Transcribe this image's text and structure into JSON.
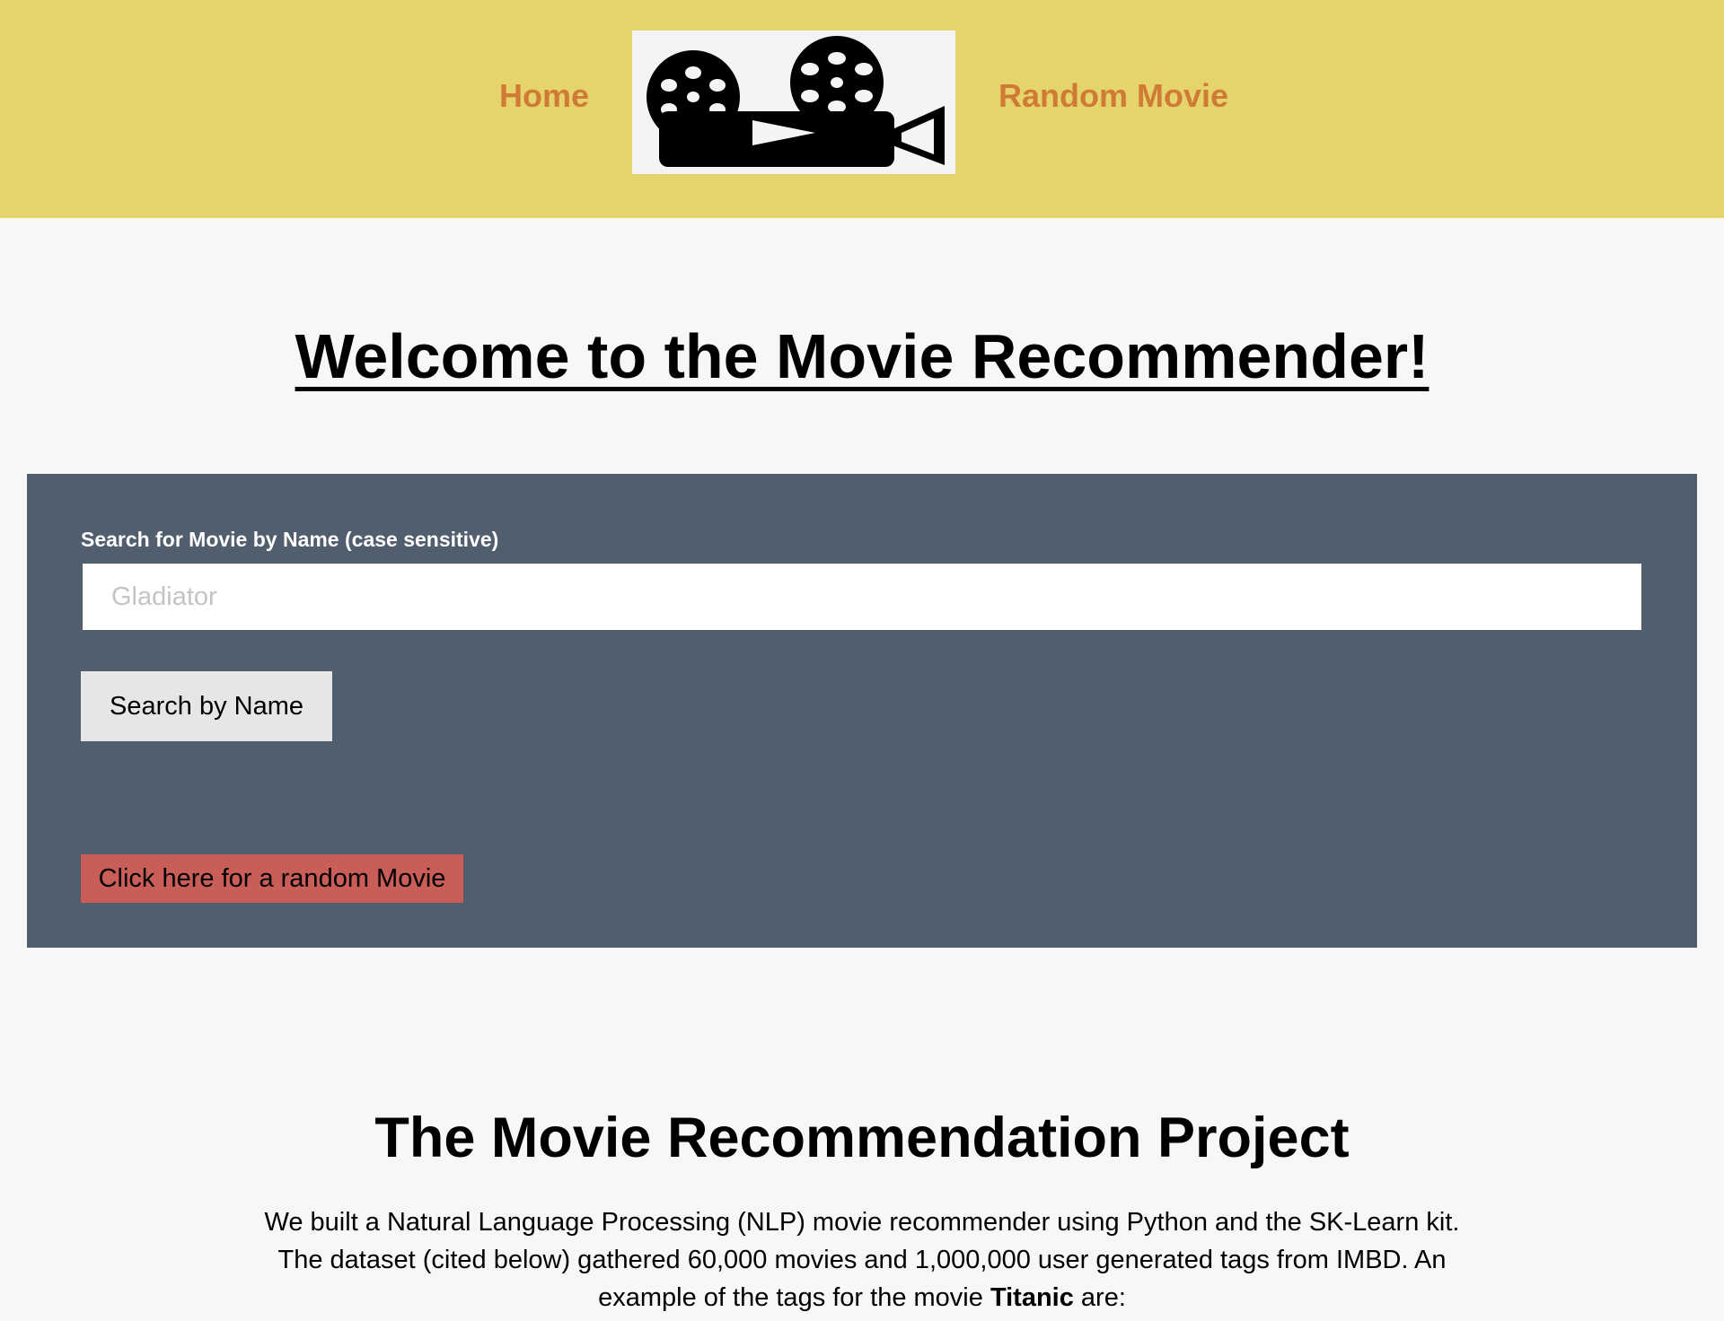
{
  "nav": {
    "home_label": "Home",
    "random_label": "Random Movie",
    "logo_icon": "film-projector-icon"
  },
  "page": {
    "title": "Welcome to the Movie Recommender!"
  },
  "search": {
    "label": "Search for Movie by Name (case sensitive)",
    "placeholder": "Gladiator",
    "button_label": "Search by Name",
    "random_button_label": "Click here for a random Movie"
  },
  "project": {
    "heading": "The Movie Recommendation Project",
    "description_part1": "We built a Natural Language Processing (NLP) movie recommender using Python and the SK-Learn kit. The dataset (cited below) gathered 60,000 movies and 1,000,000 user generated tags from IMBD. An example of the tags for the movie ",
    "description_movie": "Titanic",
    "description_part2": " are:"
  },
  "colors": {
    "topbar": "#e4d46b",
    "nav_link": "#cf7b35",
    "panel": "#515e6d",
    "random_button": "#c95d57",
    "search_button": "#e6e6e6",
    "page_background": "#f7f7f7"
  }
}
